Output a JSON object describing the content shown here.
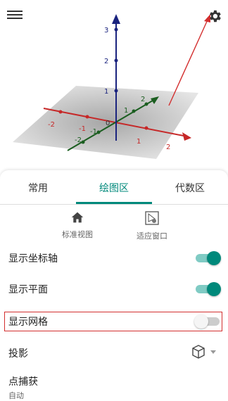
{
  "graphics": {
    "axis_labels": {
      "x": [
        "2",
        "1",
        "-1",
        "-2"
      ],
      "y": [
        "2",
        "1",
        "-1",
        "-2"
      ],
      "z": [
        "3",
        "2",
        "1"
      ],
      "origin": "0"
    }
  },
  "toolbar": {
    "menu_icon": "menu-icon",
    "settings_icon": "gear-icon"
  },
  "tabs": [
    {
      "label": "常用",
      "active": false
    },
    {
      "label": "绘图区",
      "active": true
    },
    {
      "label": "代数区",
      "active": false
    }
  ],
  "view_tools": [
    {
      "label": "标准视图",
      "icon": "home-icon"
    },
    {
      "label": "适应窗口",
      "icon": "fit-window-icon"
    }
  ],
  "settings": [
    {
      "label": "显示坐标轴",
      "on": true
    },
    {
      "label": "显示平面",
      "on": true
    },
    {
      "label": "显示网格",
      "on": false
    }
  ],
  "projection": {
    "label": "投影",
    "icon": "cube-icon"
  },
  "point_capture": {
    "label": "点捕获",
    "value": "自动"
  },
  "colors": {
    "accent": "#00897b",
    "highlight": "#d32f2f"
  }
}
